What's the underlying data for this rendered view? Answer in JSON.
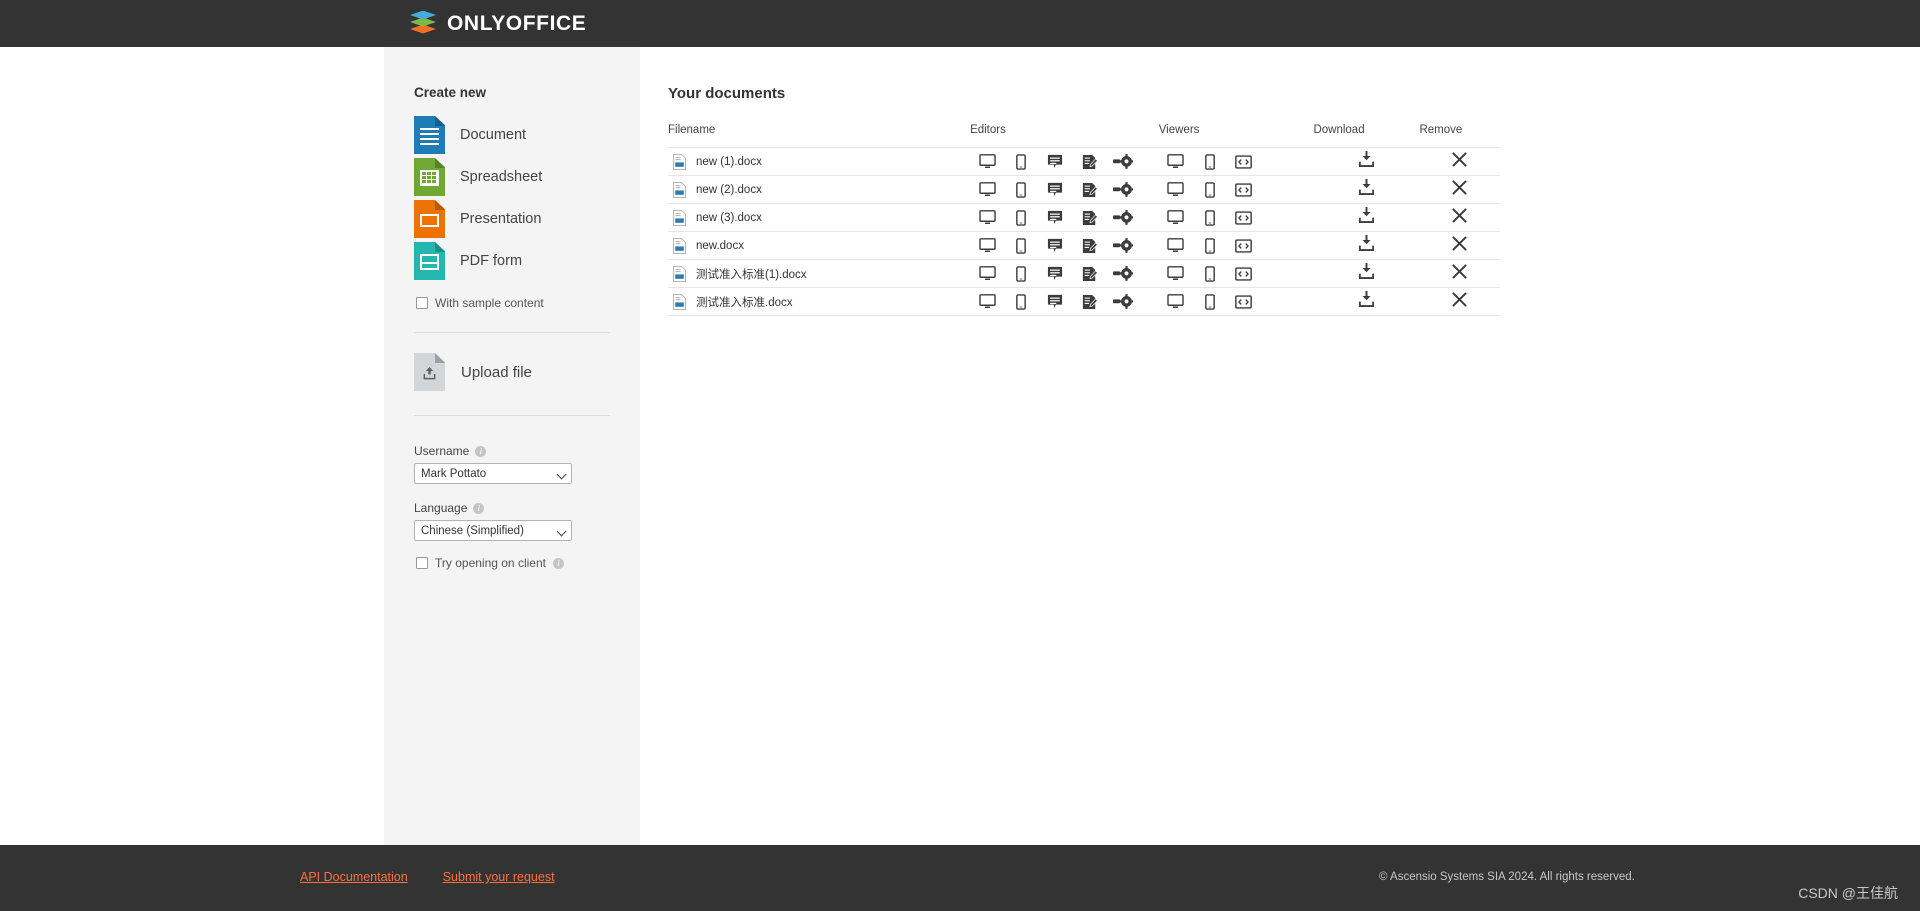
{
  "header": {
    "brand": "ONLYOFFICE",
    "logo_colors": {
      "top": "#46AADD",
      "middle": "#7DBB42",
      "bottom": "#F26F21"
    },
    "background": "#333333"
  },
  "sidebar": {
    "create_new_title": "Create new",
    "create_items": [
      {
        "label": "Document",
        "icon": "document-file-icon",
        "color": "#1F7CB4"
      },
      {
        "label": "Spreadsheet",
        "icon": "spreadsheet-file-icon",
        "color": "#6FA832"
      },
      {
        "label": "Presentation",
        "icon": "presentation-file-icon",
        "color": "#EE7202"
      },
      {
        "label": "PDF form",
        "icon": "pdf-form-file-icon",
        "color": "#25B6B0"
      }
    ],
    "sample_checkbox": {
      "label": "With sample content",
      "checked": false
    },
    "upload": {
      "label": "Upload file",
      "icon": "upload-file-icon"
    },
    "username_field": {
      "label": "Username",
      "value": "Mark Pottato",
      "info_icon": "info-icon"
    },
    "language_field": {
      "label": "Language",
      "value": "Chinese (Simplified)",
      "info_icon": "info-icon"
    },
    "client_checkbox": {
      "label": "Try opening on client",
      "checked": false,
      "info_icon": "info-icon"
    }
  },
  "main": {
    "title": "Your documents",
    "columns": {
      "filename": "Filename",
      "editors": "Editors",
      "viewers": "Viewers",
      "download": "Download",
      "remove": "Remove"
    },
    "editor_icons": [
      "desktop-editor-icon",
      "mobile-editor-icon",
      "comment-editor-icon",
      "review-editor-icon",
      "custom-gear-editor-icon"
    ],
    "viewer_icons": [
      "desktop-viewer-icon",
      "mobile-viewer-icon",
      "embedded-viewer-icon"
    ],
    "download_icon": "download-icon",
    "remove_icon": "remove-x-icon",
    "rows": [
      {
        "filename": "new (1).docx"
      },
      {
        "filename": "new (2).docx"
      },
      {
        "filename": "new (3).docx"
      },
      {
        "filename": "new.docx"
      },
      {
        "filename": "测试准入标准(1).docx"
      },
      {
        "filename": "测试准入标准.docx"
      }
    ]
  },
  "footer": {
    "links": [
      {
        "label": "API Documentation"
      },
      {
        "label": "Submit your request"
      }
    ],
    "copyright": "© Ascensio Systems SIA 2024. All rights reserved.",
    "link_color": "#ff6f3d"
  },
  "watermark": {
    "text": "CSDN @王佳航"
  }
}
